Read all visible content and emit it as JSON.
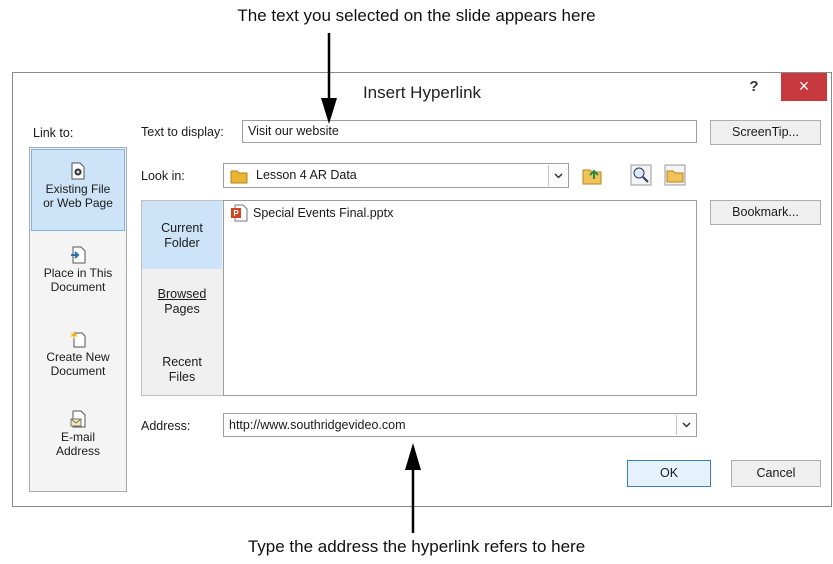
{
  "callouts": {
    "top": "The text you selected  on the slide appears here",
    "bottom": "Type the address the hyperlink refers to here"
  },
  "dialog": {
    "title": "Insert Hyperlink",
    "help": "?",
    "close": "×"
  },
  "link_to": {
    "label": "Link to:",
    "items": [
      {
        "l1": "Existing File",
        "l2": "or Web Page",
        "icon": "existing-file-icon",
        "selected": true
      },
      {
        "l1": "Place in This",
        "l2": "Document",
        "icon": "place-in-document-icon",
        "selected": false
      },
      {
        "l1": "Create New",
        "l2": "Document",
        "icon": "create-new-document-icon",
        "selected": false
      },
      {
        "l1": "E-mail",
        "l2": "Address",
        "icon": "email-address-icon",
        "selected": false
      }
    ]
  },
  "text_to_display": {
    "label": "Text to display:",
    "value": "Visit our website"
  },
  "look_in": {
    "label": "Look in:",
    "value": "Lesson 4 AR Data",
    "icon": "folder-icon"
  },
  "side_tabs": [
    {
      "l1": "Current",
      "l2": "Folder",
      "active": true
    },
    {
      "l1": "Browsed",
      "l2": "Pages",
      "active": false
    },
    {
      "l1": "Recent",
      "l2": "Files",
      "active": false
    }
  ],
  "files": [
    {
      "name": "Special Events Final.pptx",
      "icon": "powerpoint-file-icon"
    }
  ],
  "address": {
    "label": "Address:",
    "value": "http://www.southridgevideo.com"
  },
  "buttons": {
    "screentip": "ScreenTip...",
    "bookmark": "Bookmark...",
    "ok": "OK",
    "cancel": "Cancel"
  },
  "colors": {
    "accent_selected": "#cde3f7",
    "close_red": "#c7383f",
    "folder_yellow": "#e8b431"
  }
}
